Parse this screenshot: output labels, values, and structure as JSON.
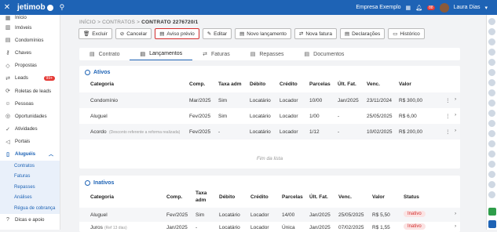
{
  "header": {
    "logo": "jetimob",
    "company": "Empresa Exemplo",
    "notif_count": "88",
    "user": "Laura Dias"
  },
  "sidebar": {
    "items": [
      {
        "label": "Início",
        "icon": "grid-icon"
      },
      {
        "label": "Imóveis",
        "icon": "building-icon"
      },
      {
        "label": "Condomínios",
        "icon": "condo-icon"
      },
      {
        "label": "Chaves",
        "icon": "key-icon"
      },
      {
        "label": "Propostas",
        "icon": "tag-icon"
      },
      {
        "label": "Leads",
        "icon": "leads-icon",
        "badge": "99+"
      },
      {
        "label": "Roletas de leads",
        "icon": "roulette-icon"
      },
      {
        "label": "Pessoas",
        "icon": "people-icon"
      },
      {
        "label": "Oportunidades",
        "icon": "target-icon"
      },
      {
        "label": "Atividades",
        "icon": "check-icon"
      },
      {
        "label": "Portais",
        "icon": "megaphone-icon"
      },
      {
        "label": "Aluguéis",
        "icon": "book-icon"
      }
    ],
    "sub": [
      "Contratos",
      "Faturas",
      "Repasses",
      "Análises",
      "Régua de cobrança"
    ],
    "bottom": "Dicas e apoio"
  },
  "breadcrumb": {
    "a": "INÍCIO",
    "b": "CONTRATOS",
    "current": "CONTRATO 2276720/1"
  },
  "actions": [
    "Excluir",
    "Cancelar",
    "Aviso prévio",
    "Editar",
    "Novo lançamento",
    "Nova fatura",
    "Declarações",
    "Histórico"
  ],
  "tabs": [
    "Contrato",
    "Lançamentos",
    "Faturas",
    "Repasses",
    "Documentos"
  ],
  "ativos": {
    "title": "Ativos",
    "headers": [
      "Categoria",
      "Comp.",
      "Taxa adm",
      "Débito",
      "Crédito",
      "Parcelas",
      "Últ. Fat.",
      "Venc.",
      "Valor"
    ],
    "rows": [
      [
        "Condomínio",
        "Mar/2025",
        "Sim",
        "Locatário",
        "Locador",
        "10/00",
        "Jan/2025",
        "23/11/2024",
        "R$ 300,00"
      ],
      [
        "Aluguel",
        "Fev/2025",
        "Sim",
        "Locatário",
        "Locador",
        "1/00",
        "-",
        "25/05/2025",
        "R$ 6,00"
      ],
      [
        "Acordo",
        "Fev/2025",
        "-",
        "Locatário",
        "Locador",
        "1/12",
        "-",
        "10/02/2025",
        "R$ 200,00"
      ]
    ],
    "acordo_note": "(Desconto referente a reforma realizada)",
    "end": "Fim da lista"
  },
  "inativos": {
    "title": "Inativos",
    "headers": [
      "Categoria",
      "Comp.",
      "Taxa",
      "adm",
      "Débito",
      "Crédito",
      "Parcelas",
      "Últ. Fat.",
      "Venc.",
      "Valor",
      "Status"
    ],
    "rows": [
      [
        "Aluguel",
        "Fev/2025",
        "Sim",
        "Locatário",
        "Locador",
        "14/00",
        "Jan/2025",
        "25/05/2025",
        "R$ 5,50",
        "Inativo"
      ],
      [
        "Juros",
        "Jan/2025",
        "-",
        "Locatário",
        "Locador",
        "Única",
        "Jan/2025",
        "07/02/2025",
        "R$ 1,55",
        "Inativo"
      ]
    ],
    "juros_note": "(Ref 13 dias)"
  }
}
